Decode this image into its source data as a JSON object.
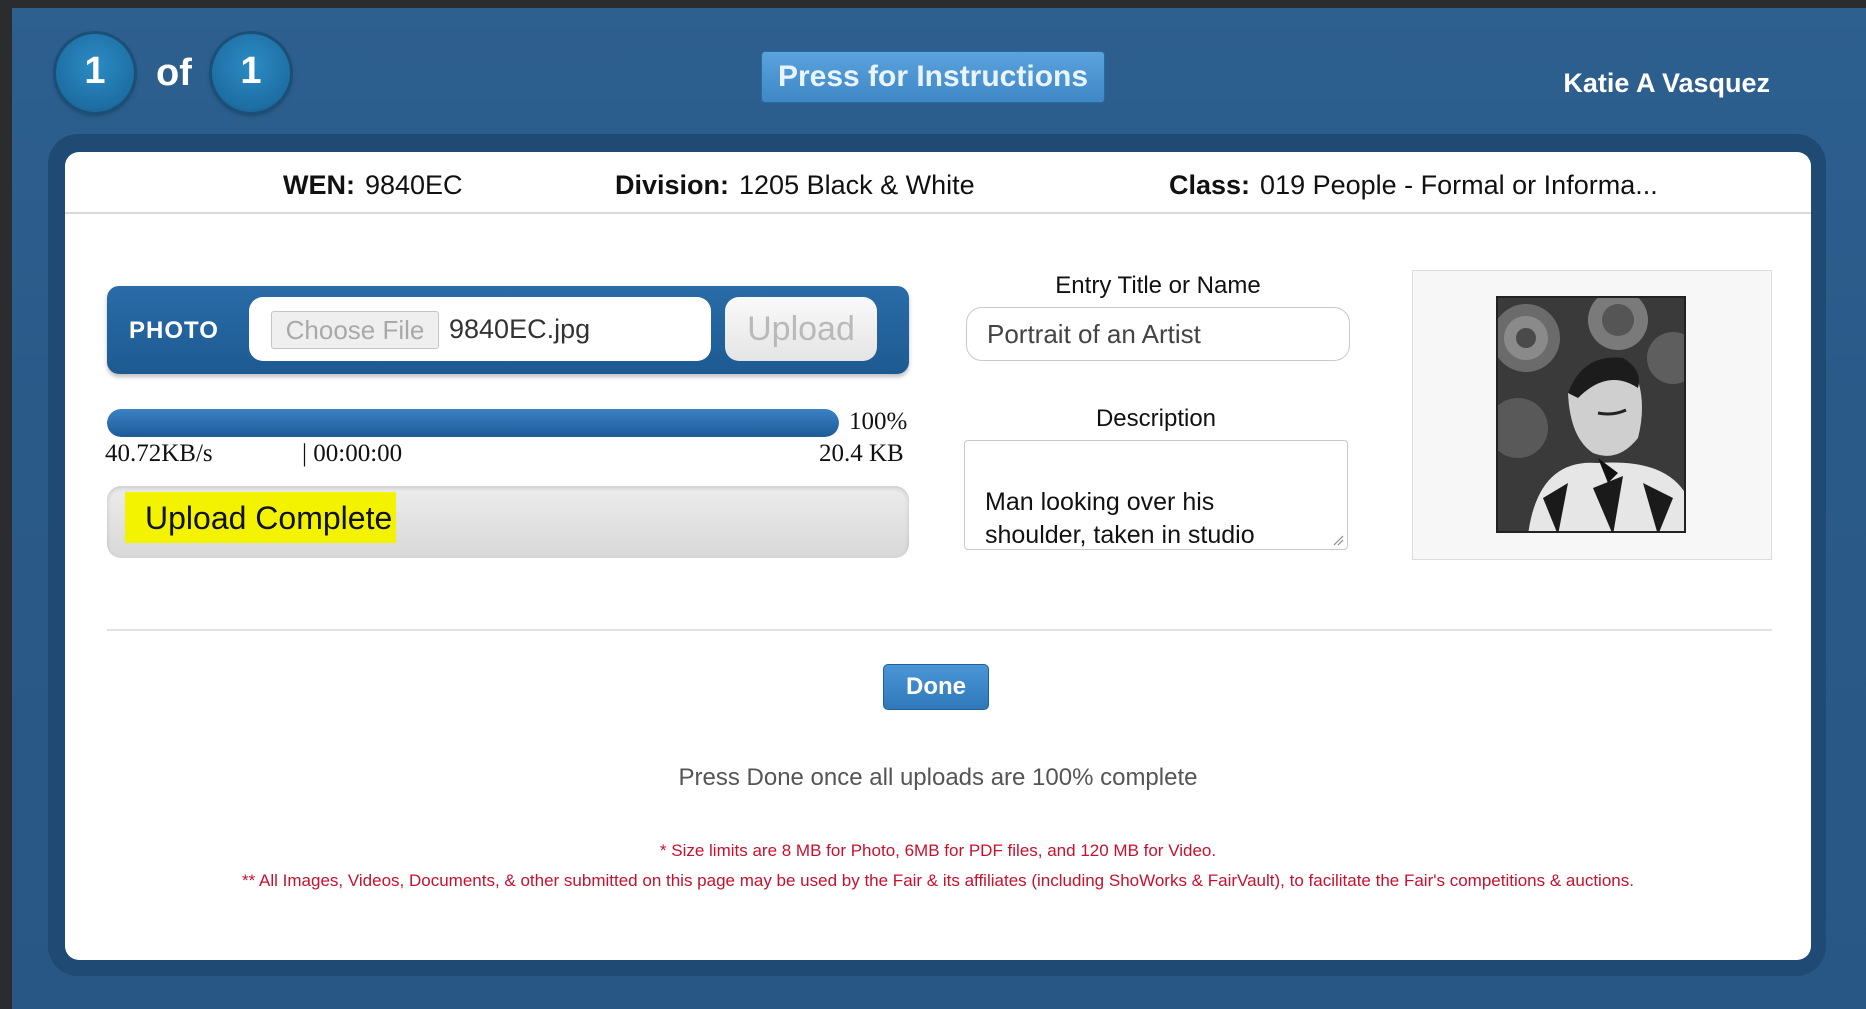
{
  "header": {
    "current": "1",
    "of_label": "of",
    "total": "1",
    "instructions_label": "Press for Instructions",
    "user_name": "Katie A Vasquez"
  },
  "entry_info": {
    "wen_label": "WEN:",
    "wen_value": "9840EC",
    "division_label": "Division:",
    "division_value": "1205 Black & White",
    "class_label": "Class:",
    "class_value": "019 People - Formal or Informa..."
  },
  "upload": {
    "photo_label": "PHOTO",
    "choose_file_label": "Choose File",
    "file_name": "9840EC.jpg",
    "upload_label": "Upload",
    "progress_fraction": 1.0,
    "percent_text": "100%",
    "speed": "40.72KB/s",
    "elapsed": "| 00:00:00",
    "size": "20.4 KB",
    "status": "Upload Complete"
  },
  "form": {
    "title_label": "Entry Title or Name",
    "title_value": "Portrait of an Artist",
    "description_label": "Description",
    "description_value": "Man looking over his\nshoulder, taken in studio"
  },
  "footer": {
    "done_label": "Done",
    "hint": "Press Done once all uploads are 100% complete",
    "size_note": "* Size limits are 8 MB for Photo, 6MB for PDF files, and 120 MB for Video.",
    "usage_note": "** All Images, Videos, Documents, & other submitted on this page may be used by the Fair & its affiliates (including ShoWorks & FairVault), to facilitate the Fair's competitions & auctions."
  },
  "colors": {
    "accent": "#2a6ca8",
    "highlight": "#f3f300",
    "note_red": "#c8102e"
  }
}
